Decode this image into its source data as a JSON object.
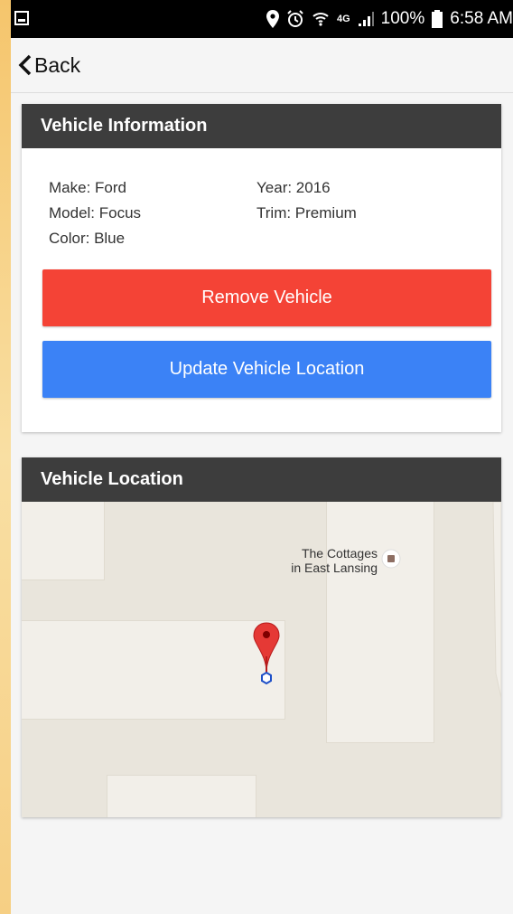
{
  "status_bar": {
    "battery": "100%",
    "time": "6:58 AM",
    "network": "4G"
  },
  "nav": {
    "back_label": "Back"
  },
  "vehicle_info": {
    "header": "Vehicle Information",
    "make": "Make: Ford",
    "model": "Model: Focus",
    "color": "Color: Blue",
    "year": "Year: 2016",
    "trim": "Trim: Premium",
    "remove_label": "Remove Vehicle",
    "update_label": "Update Vehicle Location"
  },
  "vehicle_location": {
    "header": "Vehicle Location",
    "poi_line1": "The Cottages",
    "poi_line2": "in East Lansing"
  },
  "colors": {
    "header_bg": "#3d3d3d",
    "remove_button": "#f44336",
    "update_button": "#3b82f6",
    "map_marker": "#e53935"
  }
}
